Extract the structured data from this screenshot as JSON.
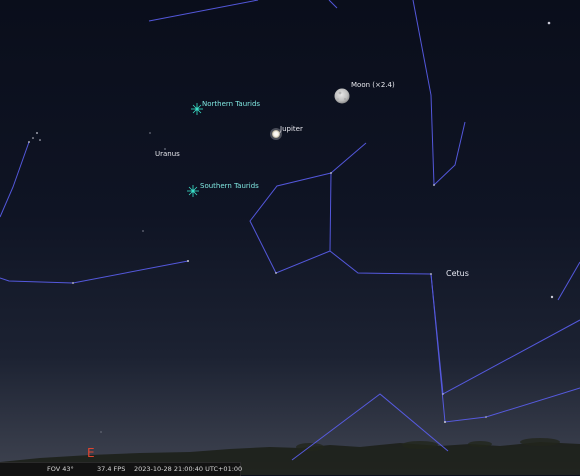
{
  "sky": {
    "colors": {
      "sky_top": "#0b0f1c",
      "sky_mid": "#141a2a",
      "horizon_glow": "#3e4350",
      "constellation_lines": "#5b5ff0",
      "meteor_shower": "#39e0c8",
      "cardinal": "#e0452f",
      "ground": "#1a1d14"
    },
    "objects": {
      "moon_label": "Moon (×2.4)",
      "jupiter_label": "Jupiter",
      "uranus_label": "Uranus"
    },
    "meteor_showers": {
      "northern_label": "Northern Taurids",
      "southern_label": "Southern Taurids"
    },
    "constellations": {
      "cetus_label": "Cetus"
    },
    "cardinal": {
      "east_label": "E"
    }
  },
  "status_bar": {
    "fov": "FOV 43°",
    "fps": "37.4 FPS",
    "datetime": "2023-10-28 21:00:40 UTC+01:00"
  }
}
